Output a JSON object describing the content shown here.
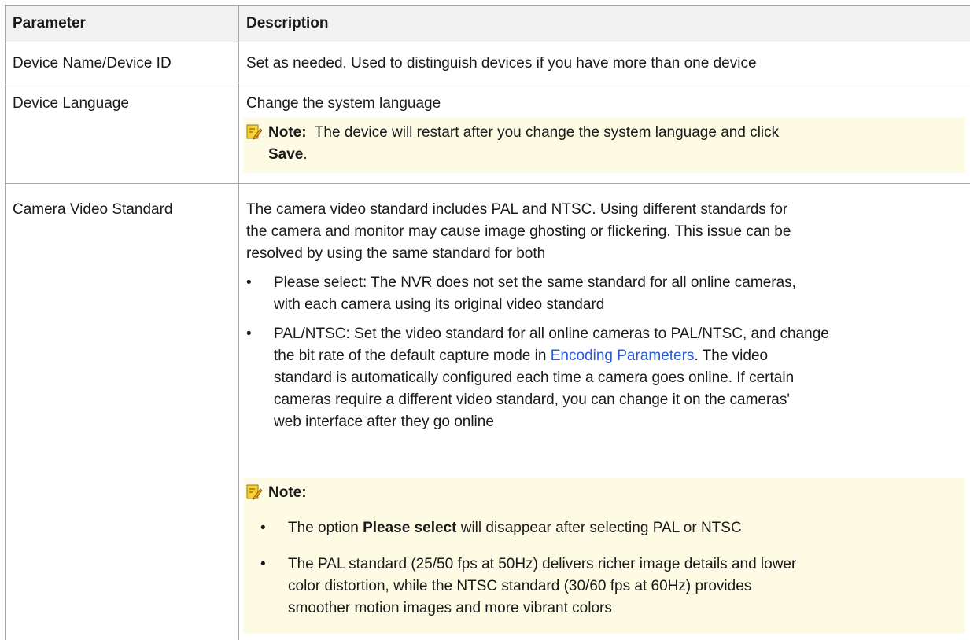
{
  "header": {
    "parameter": "Parameter",
    "description": "Description"
  },
  "rows": [
    {
      "param": "Device Name/Device ID",
      "desc": "Set as needed. Used to distinguish devices if you have more than one device"
    },
    {
      "param": "Device Language",
      "desc": "Change the system language",
      "note_label": "Note:",
      "note_text_1": "The device will restart after you change the system language and click",
      "note_save": "Save",
      "note_period": "."
    },
    {
      "param": "Camera Video Standard",
      "desc_1": "The camera video standard includes PAL and NTSC. Using different standards for",
      "desc_2": "the camera and monitor may cause image ghosting or flickering. This issue can be",
      "desc_3": "resolved by using the same standard for both",
      "bullet_1_l1": "Please select: The NVR does not set the same standard for all online cameras,",
      "bullet_1_l2": "with each camera using its original video standard",
      "bullet_2_l1": "PAL/NTSC: Set the video standard for all online cameras to PAL/NTSC, and change",
      "bullet_2_l2_pre": "the bit rate of the default capture mode in ",
      "bullet_2_link": "Encoding Parameters",
      "bullet_2_l2_post": ". The video",
      "bullet_2_l3": "standard is automatically configured each time a camera goes online. If certain",
      "bullet_2_l4": "cameras require a different video standard, you can change it on the cameras'",
      "bullet_2_l5": "web interface after they go online",
      "note_label": "Note:",
      "note_b1_pre": "The option ",
      "note_b1_bold": "Please select",
      "note_b1_post": " will disappear after selecting PAL or NTSC",
      "note_b2_l1": "The PAL standard (25/50 fps at 50Hz) delivers richer image details and lower",
      "note_b2_l2": "color distortion, while the NTSC standard (30/60 fps at 60Hz) provides",
      "note_b2_l3": "smoother motion images and more vibrant colors"
    }
  ],
  "bullet_char": "•",
  "colors": {
    "header_bg": "#f2f2f2",
    "note_bg": "#fdfbe3",
    "link": "#2a5bd7",
    "border": "#a6a6a6"
  }
}
